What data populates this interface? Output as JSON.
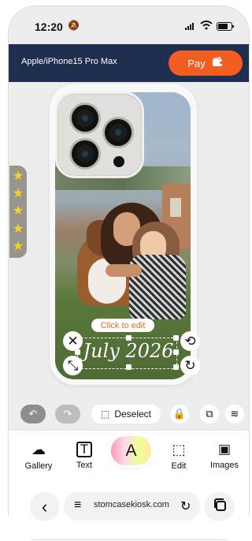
{
  "status": {
    "time": "12:20",
    "icons": [
      "bell-slash-icon",
      "signal-icon",
      "wifi-icon",
      "battery-icon"
    ]
  },
  "header": {
    "model": "Apple/iPhone15 Pro Max",
    "pay_label": "Pay",
    "pay_color": "#f25e22",
    "bar_color": "#1f2d4f"
  },
  "editor": {
    "click_to_edit": "Click to edit",
    "script_text": "July 2026",
    "stars_count": 5
  },
  "toolbar": {
    "deselect_label": "Deselect"
  },
  "bottom_menu": {
    "items": [
      {
        "label": "Gallery",
        "icon": "cloud-upload-icon"
      },
      {
        "label": "Text",
        "icon": "text-icon"
      },
      {
        "label": "",
        "icon": "text-color-icon"
      },
      {
        "label": "Edit",
        "icon": "crop-icon"
      },
      {
        "label": "Images",
        "icon": "image-icon"
      }
    ],
    "color_fab_letter": "A"
  },
  "browser": {
    "url": "stomcasekiosk.com"
  }
}
